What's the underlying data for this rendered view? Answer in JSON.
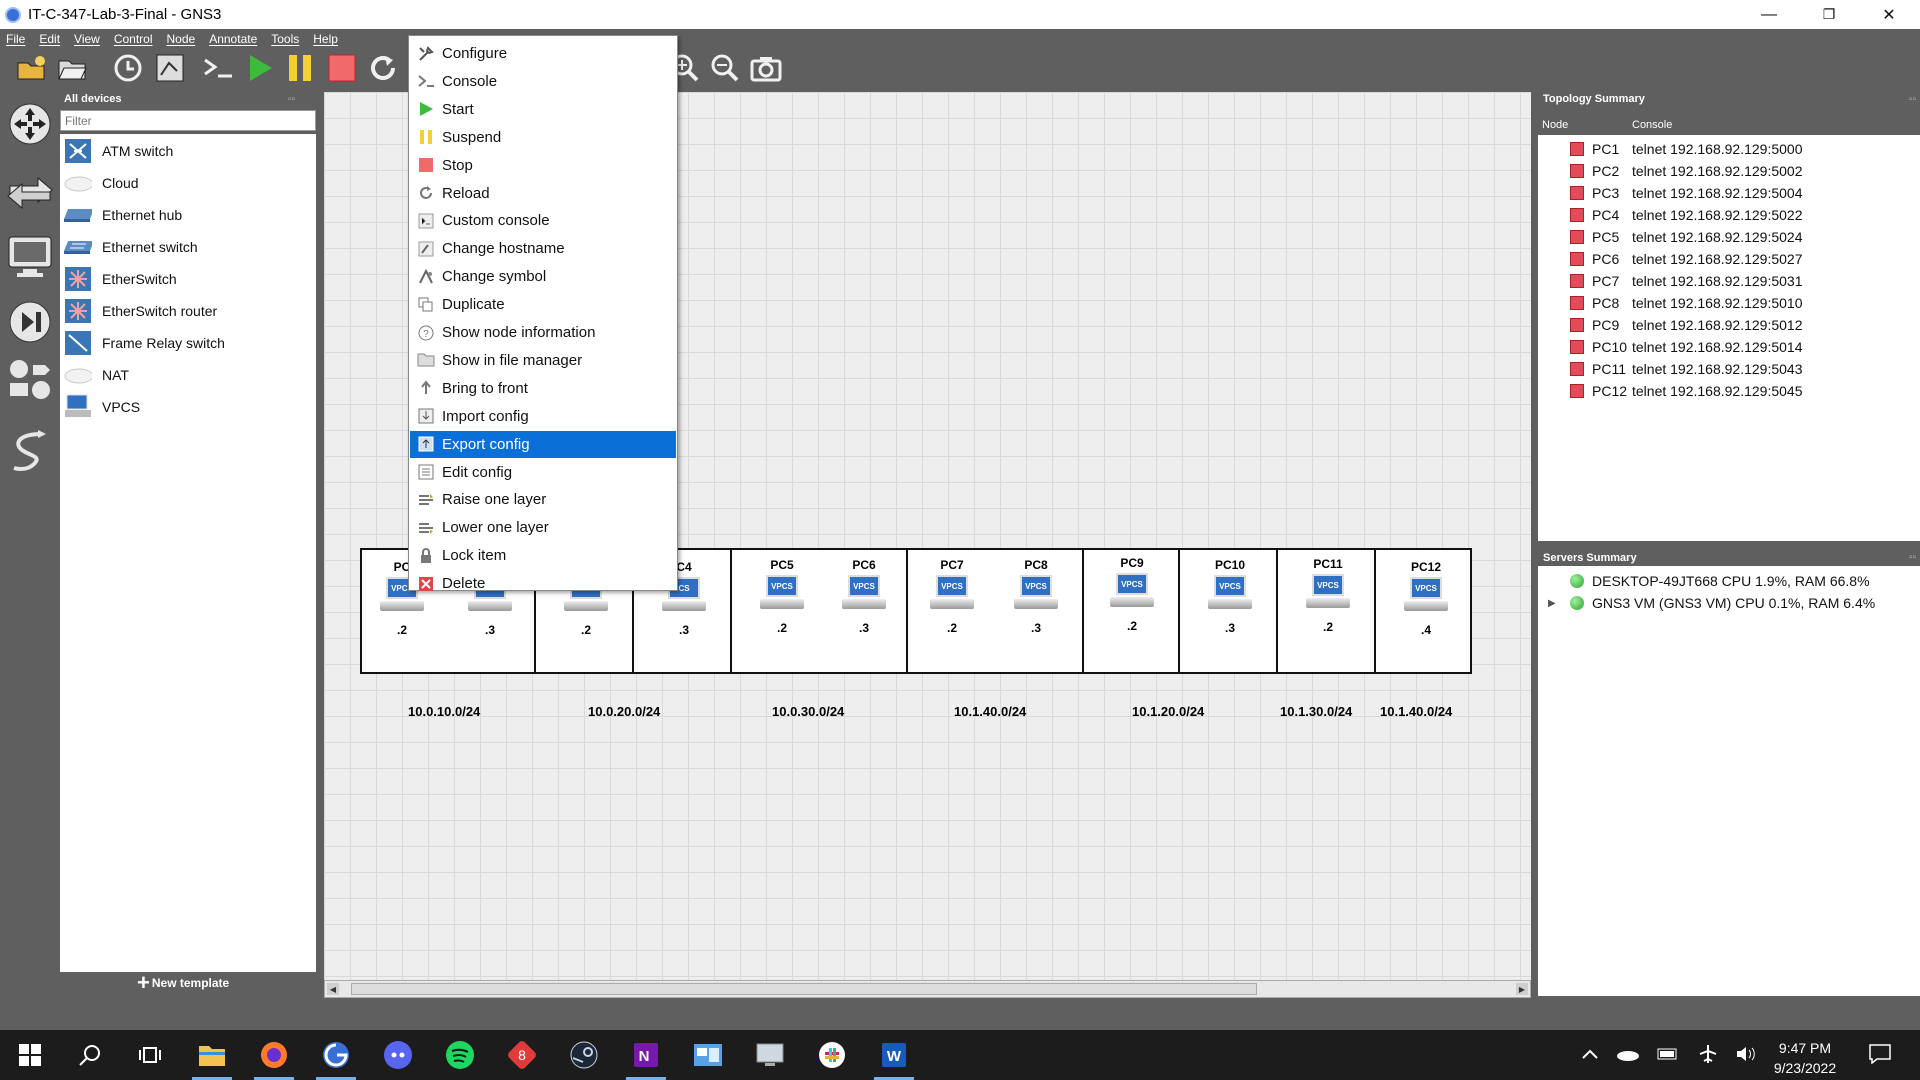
{
  "window": {
    "title": "IT-C-347-Lab-3-Final - GNS3",
    "minimize": "—",
    "restore": "❐",
    "close": "✕"
  },
  "menubar": [
    "File",
    "Edit",
    "View",
    "Control",
    "Node",
    "Annotate",
    "Tools",
    "Help"
  ],
  "toolbar": {
    "icons": [
      "new-project-icon",
      "open-project-icon",
      "snapshot-icon",
      "show-interface-labels-icon",
      "console-all-icon",
      "start-all-icon",
      "suspend-all-icon",
      "stop-all-icon",
      "reload-all-icon",
      "zoom-in-icon",
      "zoom-out-icon",
      "screenshot-icon"
    ]
  },
  "left_icons": [
    "browse-routers-icon",
    "browse-switches-icon",
    "browse-end-devices-icon",
    "browse-security-devices-icon",
    "browse-all-devices-icon",
    "add-link-icon"
  ],
  "devices_panel": {
    "title": "All devices",
    "filter_placeholder": "Filter",
    "items": [
      {
        "label": "ATM switch",
        "icon": "atm-switch-icon"
      },
      {
        "label": "Cloud",
        "icon": "cloud-icon"
      },
      {
        "label": "Ethernet hub",
        "icon": "ethernet-hub-icon"
      },
      {
        "label": "Ethernet switch",
        "icon": "ethernet-switch-icon"
      },
      {
        "label": "EtherSwitch",
        "icon": "etherswitch-icon"
      },
      {
        "label": "EtherSwitch router",
        "icon": "etherswitch-router-icon"
      },
      {
        "label": "Frame Relay switch",
        "icon": "frame-relay-switch-icon"
      },
      {
        "label": "NAT",
        "icon": "nat-icon"
      },
      {
        "label": "VPCS",
        "icon": "vpcs-icon"
      }
    ],
    "new_template": "New template"
  },
  "context_menu": {
    "items": [
      {
        "label": "Configure",
        "icon": "configure-icon",
        "selected": false
      },
      {
        "label": "Console",
        "icon": "console-icon",
        "selected": false
      },
      {
        "label": "Start",
        "icon": "start-icon",
        "selected": false
      },
      {
        "label": "Suspend",
        "icon": "suspend-icon",
        "selected": false
      },
      {
        "label": "Stop",
        "icon": "stop-icon",
        "selected": false
      },
      {
        "label": "Reload",
        "icon": "reload-icon",
        "selected": false
      },
      {
        "label": "Custom console",
        "icon": "custom-console-icon",
        "selected": false
      },
      {
        "label": "Change hostname",
        "icon": "change-hostname-icon",
        "selected": false
      },
      {
        "label": "Change symbol",
        "icon": "change-symbol-icon",
        "selected": false
      },
      {
        "label": "Duplicate",
        "icon": "duplicate-icon",
        "selected": false
      },
      {
        "label": "Show node information",
        "icon": "info-icon",
        "selected": false
      },
      {
        "label": "Show in file manager",
        "icon": "folder-icon",
        "selected": false
      },
      {
        "label": "Bring to front",
        "icon": "bring-to-front-icon",
        "selected": false
      },
      {
        "label": "Import config",
        "icon": "import-config-icon",
        "selected": false
      },
      {
        "label": "Export config",
        "icon": "export-config-icon",
        "selected": true
      },
      {
        "label": "Edit config",
        "icon": "edit-config-icon",
        "selected": false
      },
      {
        "label": "Raise one layer",
        "icon": "raise-layer-icon",
        "selected": false
      },
      {
        "label": "Lower one layer",
        "icon": "lower-layer-icon",
        "selected": false
      },
      {
        "label": "Lock item",
        "icon": "lock-icon",
        "selected": false
      },
      {
        "label": "Delete",
        "icon": "delete-icon",
        "selected": false
      }
    ]
  },
  "topology": {
    "nodes": [
      {
        "name": "PC",
        "ip": ".2",
        "screen": "VPCS"
      },
      {
        "name": "",
        "ip": ".3",
        "screen": ""
      },
      {
        "name": "",
        "ip": ".2",
        "screen": ""
      },
      {
        "name": "C4",
        "ip": ".3",
        "screen": "CS"
      },
      {
        "name": "PC5",
        "ip": ".2",
        "screen": "VPCS"
      },
      {
        "name": "PC6",
        "ip": ".3",
        "screen": "VPCS"
      },
      {
        "name": "PC7",
        "ip": ".2",
        "screen": "VPCS"
      },
      {
        "name": "PC8",
        "ip": ".3",
        "screen": "VPCS"
      },
      {
        "name": "PC9",
        "ip": ".2",
        "screen": "VPCS"
      },
      {
        "name": "PC10",
        "ip": ".3",
        "screen": "VPCS"
      },
      {
        "name": "PC11",
        "ip": ".2",
        "screen": "VPCS"
      },
      {
        "name": "PC12",
        "ip": ".4",
        "screen": "VPCS"
      }
    ],
    "subnets": [
      "10.0.10.0/24",
      "10.0.20.0/24",
      "10.0.30.0/24",
      "10.1.40.0/24",
      "10.1.20.0/24",
      "10.1.30.0/24",
      "10.1.40.0/24"
    ]
  },
  "topology_summary": {
    "title": "Topology Summary",
    "columns": [
      "Node",
      "Console"
    ],
    "rows": [
      {
        "node": "PC1",
        "console": "telnet 192.168.92.129:5000"
      },
      {
        "node": "PC2",
        "console": "telnet 192.168.92.129:5002"
      },
      {
        "node": "PC3",
        "console": "telnet 192.168.92.129:5004"
      },
      {
        "node": "PC4",
        "console": "telnet 192.168.92.129:5022"
      },
      {
        "node": "PC5",
        "console": "telnet 192.168.92.129:5024"
      },
      {
        "node": "PC6",
        "console": "telnet 192.168.92.129:5027"
      },
      {
        "node": "PC7",
        "console": "telnet 192.168.92.129:5031"
      },
      {
        "node": "PC8",
        "console": "telnet 192.168.92.129:5010"
      },
      {
        "node": "PC9",
        "console": "telnet 192.168.92.129:5012"
      },
      {
        "node": "PC10",
        "console": "telnet 192.168.92.129:5014"
      },
      {
        "node": "PC11",
        "console": "telnet 192.168.92.129:5043"
      },
      {
        "node": "PC12",
        "console": "telnet 192.168.92.129:5045"
      }
    ]
  },
  "servers_summary": {
    "title": "Servers Summary",
    "rows": [
      {
        "text": "DESKTOP-49JT668 CPU 1.9%, RAM 66.8%"
      },
      {
        "text": "GNS3 VM (GNS3 VM) CPU 0.1%, RAM 6.4%"
      }
    ]
  },
  "taskbar": {
    "apps": [
      "windows-start-icon",
      "search-icon",
      "task-view-icon",
      "file-explorer-icon",
      "firefox-icon",
      "gns3-icon",
      "discord-icon",
      "spotify-icon",
      "git-icon",
      "steam-icon",
      "onenote-icon",
      "control-panel-icon",
      "remote-desktop-icon",
      "slack-icon",
      "word-icon"
    ],
    "time": "9:47 PM",
    "date": "9/23/2022"
  },
  "colors": {
    "accent": "#0a6fd6",
    "panel": "#5f5f5f",
    "stopped": "#e34b5a",
    "running": "#2aa52a"
  }
}
